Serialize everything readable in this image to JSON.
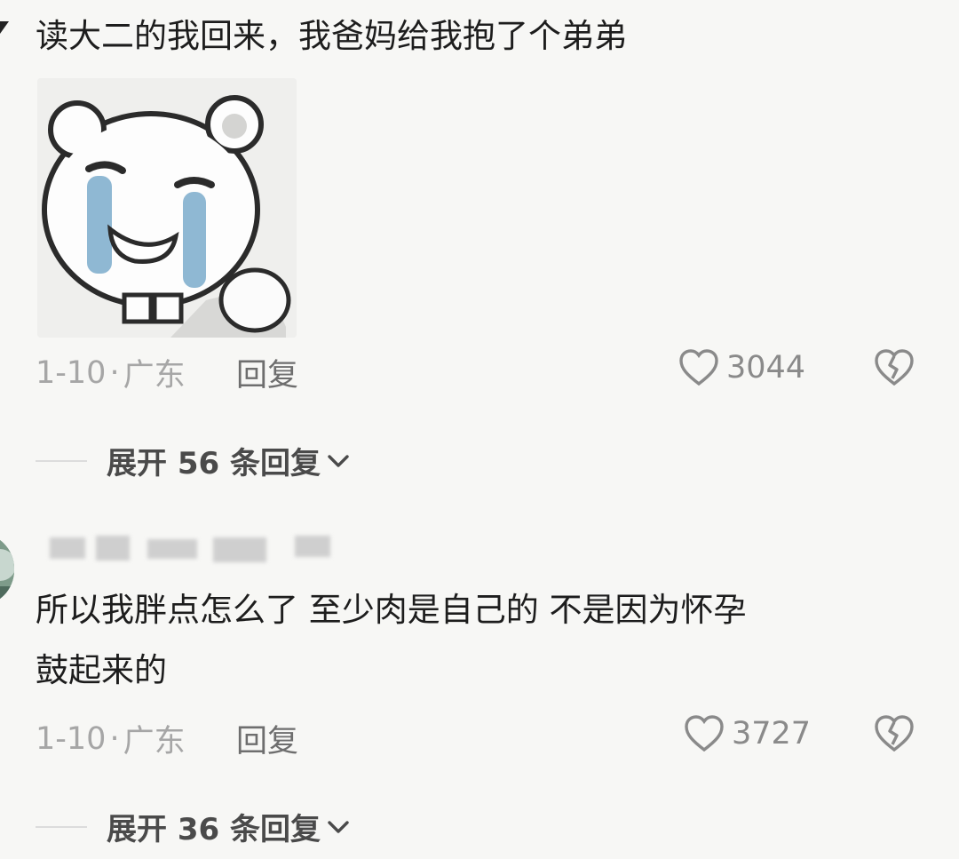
{
  "comment1": {
    "text": "读大二的我回来，我爸妈给我抱了个弟弟",
    "date": "1-10",
    "dot": "·",
    "location": "广东",
    "reply_label": "回复",
    "likes": "3044",
    "expand_label": "展开 56 条回复"
  },
  "comment2": {
    "text_line1": "所以我胖点怎么了 至少肉是自己的 不是因为怀孕",
    "text_line2": "鼓起来的",
    "date": "1-10",
    "dot": "·",
    "location": "广东",
    "reply_label": "回复",
    "likes": "3727",
    "expand_label": "展开 36 条回复"
  },
  "icons": {
    "like": "heart-outline-icon",
    "dislike": "broken-heart-icon",
    "expand": "chevron-down-icon",
    "sticker": "crying-bear-sticker"
  },
  "colors": {
    "background": "#f7f7f5",
    "text": "#1d1d1d",
    "meta": "#a6a6a6",
    "tears": "#8fb8d3"
  }
}
